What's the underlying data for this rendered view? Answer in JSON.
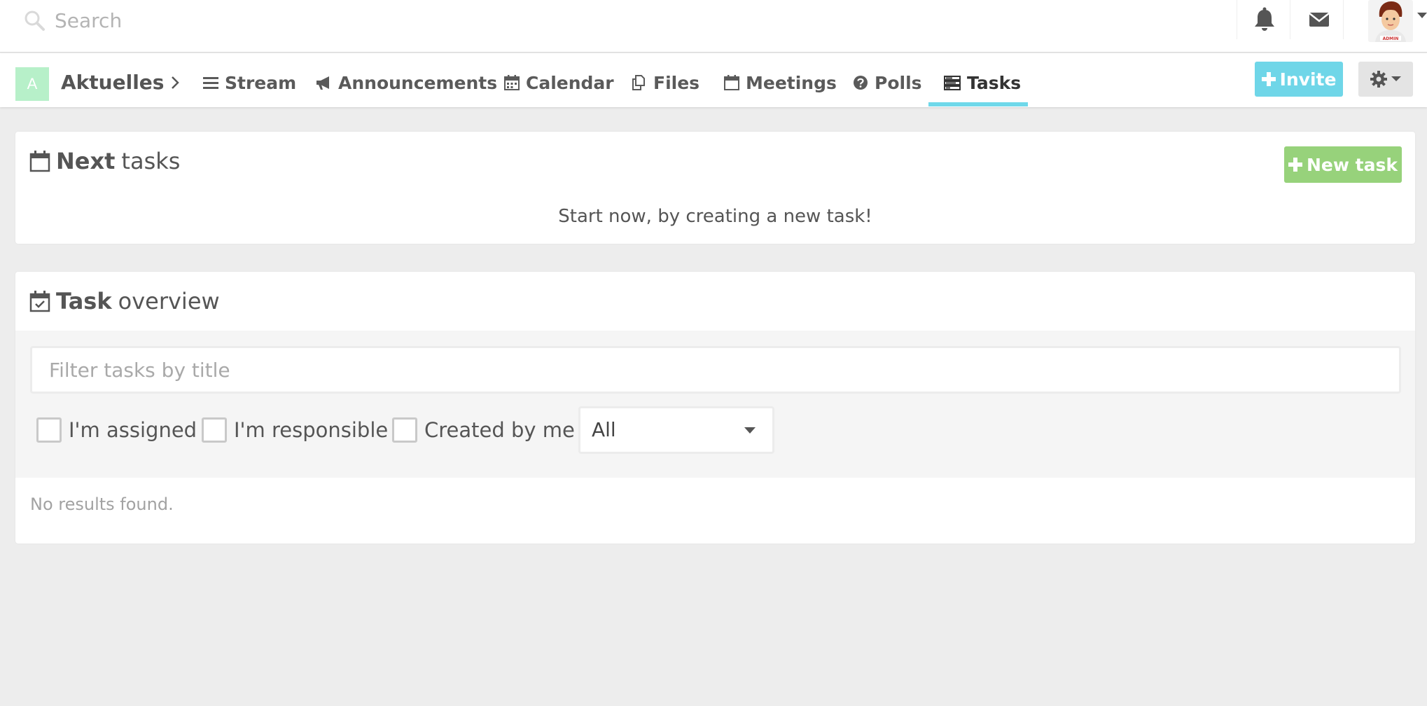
{
  "topbar": {
    "search_placeholder": "Search",
    "search_icon": "search-icon",
    "notifications_icon": "bell-icon",
    "messages_icon": "envelope-icon",
    "avatar_badge": "ADMIN"
  },
  "space": {
    "initial": "A",
    "name": "Aktuelles",
    "logo_color": "#b7f0c9"
  },
  "nav": {
    "items": [
      {
        "label": "Stream",
        "icon": "list-icon"
      },
      {
        "label": "Announcements",
        "icon": "bullhorn-icon"
      },
      {
        "label": "Calendar",
        "icon": "calendar-icon"
      },
      {
        "label": "Files",
        "icon": "files-icon"
      },
      {
        "label": "Meetings",
        "icon": "calendar-outline-icon"
      },
      {
        "label": "Polls",
        "icon": "question-circle-icon"
      },
      {
        "label": "Tasks",
        "icon": "tasks-icon",
        "active": true
      }
    ],
    "invite_label": "Invite",
    "settings_icon": "gear-icon",
    "accent_color": "#6fd8ea"
  },
  "next_tasks": {
    "title_bold": "Next",
    "title_rest": "tasks",
    "new_task_label": "New task",
    "empty_text": "Start now, by creating a new task!",
    "button_color": "#97d27b"
  },
  "task_overview": {
    "title_bold": "Task",
    "title_rest": "overview",
    "filter_placeholder": "Filter tasks by title",
    "checkboxes": [
      "I'm assigned",
      "I'm responsible",
      "Created by me"
    ],
    "status_select": "All",
    "no_results": "No results found."
  }
}
